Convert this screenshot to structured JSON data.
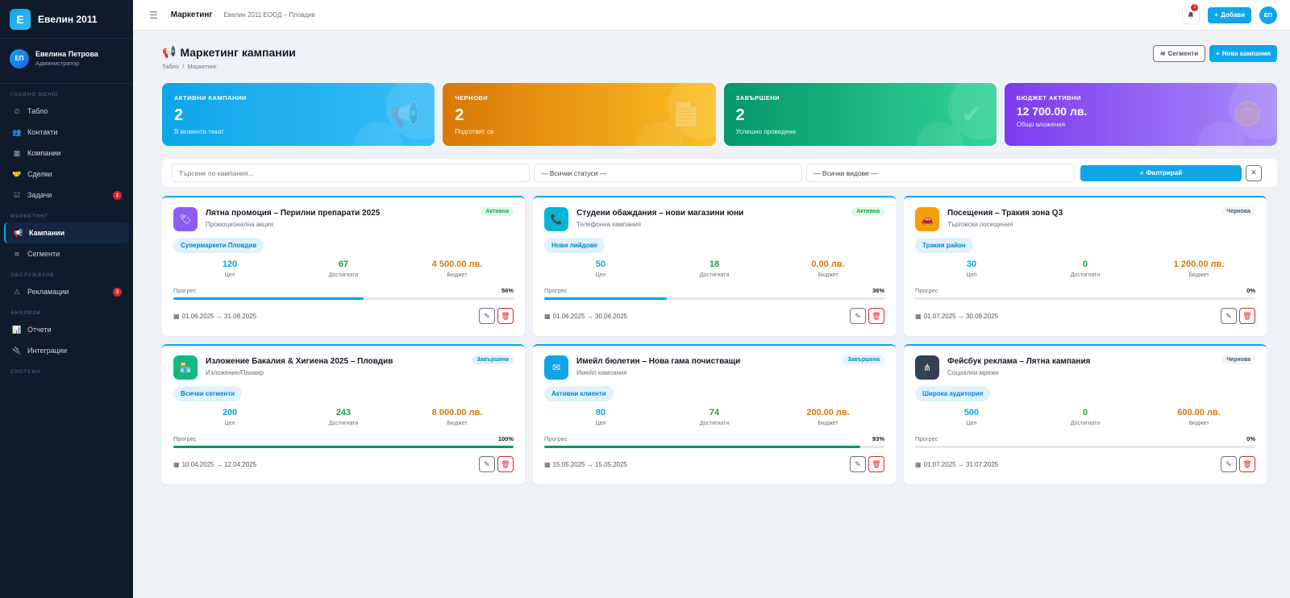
{
  "brand": {
    "logo_letter": "Е",
    "name": "Евелин 2011"
  },
  "user": {
    "initials": "ЕП",
    "name": "Евелина Петрова",
    "role": "Администратор"
  },
  "sidebar": {
    "sections": [
      {
        "title": "ГЛАВНО МЕНЮ",
        "items": [
          {
            "label": "Табло",
            "icon": "⏲",
            "icon_name": "dashboard-icon"
          },
          {
            "label": "Контакти",
            "icon": "👥",
            "icon_name": "users-icon"
          },
          {
            "label": "Компании",
            "icon": "▦",
            "icon_name": "building-icon"
          },
          {
            "label": "Сделки",
            "icon": "🤝",
            "icon_name": "handshake-icon"
          },
          {
            "label": "Задачи",
            "icon": "☑",
            "icon_name": "tasks-icon",
            "badge": "1"
          }
        ]
      },
      {
        "title": "МАРКЕТИНГ",
        "items": [
          {
            "label": "Кампании",
            "icon": "📢",
            "icon_name": "megaphone-icon",
            "active": true
          },
          {
            "label": "Сегменти",
            "icon": "≋",
            "icon_name": "layers-icon"
          }
        ]
      },
      {
        "title": "ОБСЛУЖВАНЕ",
        "items": [
          {
            "label": "Рекламации",
            "icon": "⚠",
            "icon_name": "warning-icon",
            "badge": "3"
          }
        ]
      },
      {
        "title": "АНАЛИЗИ",
        "items": [
          {
            "label": "Отчети",
            "icon": "📊",
            "icon_name": "chart-icon"
          },
          {
            "label": "Интеграции",
            "icon": "🔌",
            "icon_name": "plug-icon"
          }
        ]
      },
      {
        "title": "СИСТЕМА",
        "items": []
      }
    ]
  },
  "topbar": {
    "title": "Маркетинг",
    "subtitle": "Евелин 2011 ЕООД – Пловдив",
    "bell_badge": "1",
    "add_label": "Добави",
    "avatar": "ЕП"
  },
  "page": {
    "title": "Маркетинг кампании",
    "breadcrumb_home": "Табло",
    "breadcrumb_sep": "/",
    "breadcrumb_current": "Маркетинг",
    "segments_label": "Сегменти",
    "new_campaign_label": "Нова кампания"
  },
  "stats": [
    {
      "label": "АКТИВНИ КАМПАНИИ",
      "value": "2",
      "sub": "В момента текат",
      "icon": "📢"
    },
    {
      "label": "ЧЕРНОВИ",
      "value": "2",
      "sub": "Подготвят се",
      "icon": "📄"
    },
    {
      "label": "ЗАВЪРШЕНИ",
      "value": "2",
      "sub": "Успешно проведени",
      "icon": "✔"
    },
    {
      "label": "БЮДЖЕТ АКТИВНИ",
      "value": "12 700.00 лв.",
      "sub": "Общо вложения",
      "icon": "🪙"
    }
  ],
  "filters": {
    "search_placeholder": "Търсене по кампания...",
    "status_value": "— Всички статуси —",
    "type_value": "— Всички видове —",
    "filter_label": "Филтрирай",
    "clear_label": "✕"
  },
  "metric_labels": {
    "target": "Цел",
    "reached": "Достигнати",
    "budget": "Бюджет",
    "progress": "Прогрес"
  },
  "campaigns": [
    {
      "title": "Лятна промоция – Перилни препарати 2025",
      "type": "Промоционална акция",
      "status": "Активна",
      "status_kind": "active",
      "segment": "Супермаркети Пловдив",
      "target": "120",
      "reached": "67",
      "budget": "4 500.00 лв.",
      "progress": 56,
      "progress_text": "56%",
      "dates": "01.06.2025 → 31.08.2025",
      "icon": "🏷",
      "icon_name": "tag-icon",
      "icon_color": "#8b5cf6"
    },
    {
      "title": "Студени обаждания – нови магазини юни",
      "type": "Телефонна кампания",
      "status": "Активна",
      "status_kind": "active",
      "segment": "Нови лийдове",
      "target": "50",
      "reached": "18",
      "budget": "0.00 лв.",
      "progress": 36,
      "progress_text": "36%",
      "dates": "01.06.2025 → 30.06.2025",
      "icon": "📞",
      "icon_name": "phone-icon",
      "icon_color": "#06b6d4"
    },
    {
      "title": "Посещения – Тракия зона Q3",
      "type": "Търговски посещения",
      "status": "Чернова",
      "status_kind": "draft",
      "segment": "Тракия район",
      "target": "30",
      "reached": "0",
      "budget": "1 200.00 лв.",
      "progress": 0,
      "progress_text": "0%",
      "dates": "01.07.2025 → 30.09.2025",
      "icon": "🚗",
      "icon_name": "car-icon",
      "icon_color": "#f59e0b"
    },
    {
      "title": "Изложение Бакалия & Хигиена 2025 – Пловдив",
      "type": "Изложение/Панаир",
      "status": "Завършена",
      "status_kind": "done",
      "segment": "Всички сегменти",
      "target": "200",
      "reached": "243",
      "budget": "8 000.00 лв.",
      "progress": 100,
      "progress_text": "100%",
      "dates": "10.04.2025 → 12.04.2025",
      "icon": "🏪",
      "icon_name": "store-icon",
      "icon_color": "#10b981"
    },
    {
      "title": "Имейл бюлетин – Нова гама почистващи",
      "type": "Имейл кампания",
      "status": "Завършена",
      "status_kind": "done",
      "segment": "Активни клиенти",
      "target": "80",
      "reached": "74",
      "budget": "200.00 лв.",
      "progress": 93,
      "progress_text": "93%",
      "dates": "15.05.2025 → 15.05.2025",
      "icon": "✉",
      "icon_name": "mail-icon",
      "icon_color": "#0ea5e9"
    },
    {
      "title": "Фейсбук реклама – Лятна кампания",
      "type": "Социални мрежи",
      "status": "Чернова",
      "status_kind": "draft",
      "segment": "Широка аудитория",
      "target": "500",
      "reached": "0",
      "budget": "600.00 лв.",
      "progress": 0,
      "progress_text": "0%",
      "dates": "01.07.2025 → 31.07.2025",
      "icon": "⋔",
      "icon_name": "share-icon",
      "icon_color": "#334155"
    }
  ],
  "colors": {
    "accent": "#0ea5e9",
    "target": "#0ea5e9",
    "reached": "#16a34a",
    "budget": "#d97706",
    "bar_fill": "#0ea5e9",
    "bar_fill_done": "#059669"
  }
}
